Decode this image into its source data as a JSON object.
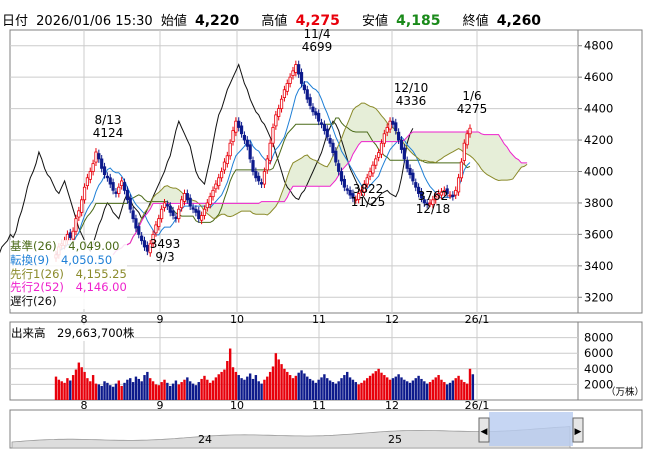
{
  "header": {
    "date_label": "日付",
    "datetime": "2026/01/06 15:30",
    "open_label": "始値",
    "open": "4,220",
    "high_label": "高値",
    "high": "4,275",
    "low_label": "安値",
    "low": "4,185",
    "close_label": "終値",
    "close": "4,260"
  },
  "colors": {
    "up": "#e8000b",
    "down": "#0d1a8c",
    "kijun": "#4a6a18",
    "tenkan": "#1e7fd6",
    "senkou1": "#8a8a2a",
    "senkou2": "#ee22cc",
    "chikou": "#111111",
    "cloud": "#e6eed8",
    "grid": "#cccccc",
    "high_text": "#e8000b",
    "low_text": "#1a8a1a"
  },
  "legend": [
    {
      "label": "基準(26)",
      "value": "4,049.00",
      "color_key": "kijun"
    },
    {
      "label": "転換(9)",
      "value": "4,050.50",
      "color_key": "tenkan"
    },
    {
      "label": "先行1(26)",
      "value": "4,155.25",
      "color_key": "senkou1"
    },
    {
      "label": "先行2(52)",
      "value": "4,146.00",
      "color_key": "senkou2"
    },
    {
      "label": "遅行(26)",
      "value": "",
      "color_key": "chikou"
    }
  ],
  "volume_label": "出来高　29,663,700株",
  "chart_data": {
    "type": "candlestick",
    "price_axis": {
      "ylim": [
        3100,
        4900
      ],
      "ticks": [
        3200,
        3400,
        3600,
        3800,
        4000,
        4200,
        4400,
        4600,
        4800
      ]
    },
    "volume_axis": {
      "ylim": [
        0,
        10000
      ],
      "ticks": [
        2000,
        4000,
        6000,
        8000
      ],
      "unit": "（万株）"
    },
    "x_ticks": [
      "8",
      "9",
      "10",
      "11",
      "12",
      "26/1"
    ],
    "annotations": [
      {
        "date": "8/13",
        "value": "4124"
      },
      {
        "date": "9/3",
        "value": "3493"
      },
      {
        "date": "11/4",
        "value": "4699"
      },
      {
        "date": "11/25",
        "value": "3822"
      },
      {
        "date": "12/10",
        "value": "4336"
      },
      {
        "date": "12/18",
        "value": "3762"
      },
      {
        "date": "1/6",
        "value": "4275"
      }
    ],
    "close": [
      3470,
      3520,
      3540,
      3560,
      3600,
      3580,
      3620,
      3700,
      3750,
      3820,
      3900,
      3960,
      4000,
      4050,
      4124,
      4080,
      4020,
      3980,
      3960,
      3920,
      3880,
      3860,
      3900,
      3940,
      3880,
      3820,
      3760,
      3700,
      3640,
      3600,
      3560,
      3520,
      3493,
      3540,
      3600,
      3660,
      3700,
      3760,
      3800,
      3780,
      3740,
      3720,
      3700,
      3760,
      3820,
      3860,
      3820,
      3780,
      3760,
      3740,
      3700,
      3720,
      3760,
      3800,
      3840,
      3880,
      3920,
      3960,
      4000,
      4060,
      4100,
      4180,
      4260,
      4320,
      4280,
      4240,
      4200,
      4160,
      4080,
      4000,
      3960,
      3940,
      3920,
      4000,
      4080,
      4180,
      4280,
      4360,
      4400,
      4460,
      4520,
      4560,
      4600,
      4640,
      4680,
      4620,
      4560,
      4520,
      4460,
      4420,
      4380,
      4360,
      4320,
      4300,
      4260,
      4220,
      4180,
      4120,
      4060,
      4000,
      3940,
      3900,
      3880,
      3850,
      3830,
      3822,
      3860,
      3880,
      3920,
      3960,
      4000,
      4040,
      4080,
      4120,
      4180,
      4240,
      4280,
      4320,
      4300,
      4260,
      4200,
      4140,
      4080,
      4020,
      3980,
      3940,
      3900,
      3860,
      3830,
      3800,
      3790,
      3800,
      3820,
      3840,
      3860,
      3870,
      3880,
      3860,
      3850,
      3840,
      3880,
      3960,
      4060,
      4180,
      4240,
      4275
    ],
    "volume": [
      3000,
      2600,
      2400,
      2200,
      2800,
      2500,
      3200,
      3900,
      4800,
      4200,
      3600,
      2800,
      2400,
      3200,
      2100,
      2000,
      1800,
      2400,
      2200,
      1900,
      1700,
      2100,
      2500,
      1800,
      2200,
      2600,
      2800,
      2300,
      3000,
      2700,
      2400,
      3200,
      3600,
      2800,
      2400,
      2000,
      1900,
      2300,
      2600,
      2200,
      1800,
      2100,
      2500,
      2000,
      2300,
      2600,
      2900,
      2400,
      2100,
      1900,
      2300,
      2700,
      3100,
      2600,
      2200,
      2500,
      2900,
      3300,
      3600,
      3900,
      5000,
      6600,
      4200,
      3600,
      3200,
      2800,
      2600,
      3000,
      3400,
      2700,
      3200,
      2400,
      2100,
      2600,
      3000,
      3600,
      4300,
      6000,
      5200,
      4600,
      4000,
      3600,
      3200,
      2800,
      3100,
      3500,
      3800,
      3400,
      3000,
      2700,
      2500,
      2200,
      2600,
      2900,
      3300,
      2800,
      2500,
      2300,
      2100,
      2400,
      2800,
      3200,
      3600,
      2900,
      2600,
      2300,
      2000,
      2200,
      2500,
      2800,
      3100,
      3400,
      3700,
      4000,
      3500,
      3200,
      2900,
      2600,
      2800,
      3000,
      3300,
      2900,
      2600,
      2400,
      2200,
      2500,
      2800,
      3100,
      2700,
      2400,
      2100,
      2300,
      2600,
      2900,
      3200,
      2600,
      2300,
      2000,
      2200,
      2500,
      2800,
      3100,
      2600,
      2300,
      2100,
      4000,
      3300
    ]
  },
  "navigator_labels": [
    "24",
    "25"
  ],
  "navigator_arrows": {
    "left": "◀",
    "right": "▶"
  }
}
